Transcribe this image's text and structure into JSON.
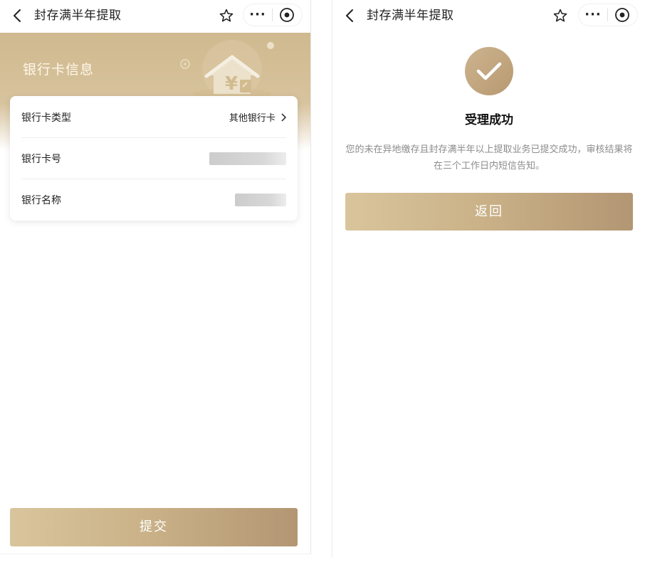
{
  "navbar": {
    "title": "封存满半年提取",
    "more_label": "···"
  },
  "left": {
    "banner_title": "银行卡信息",
    "rows": [
      {
        "label": "银行卡类型",
        "value": "其他银行卡"
      },
      {
        "label": "银行卡号",
        "value": ""
      },
      {
        "label": "银行名称",
        "value": ""
      }
    ],
    "submit_label": "提交"
  },
  "right": {
    "status_title": "受理成功",
    "message": "您的未在异地缴存且封存满半年以上提取业务已提交成功，审核结果将在三个工作日内短信告知。",
    "return_label": "返回"
  },
  "icons": {
    "back": "chevron-left-icon",
    "favorite": "star-outline-icon",
    "more": "more-dots-icon",
    "target": "target-circle-icon",
    "success": "checkmark-circle-icon",
    "row_arrow": "chevron-right-icon"
  },
  "colors": {
    "gold_light": "#d9c59c",
    "gold_dark": "#b39673",
    "banner": "#cfb98f",
    "desc_text": "#8c8c8c"
  }
}
